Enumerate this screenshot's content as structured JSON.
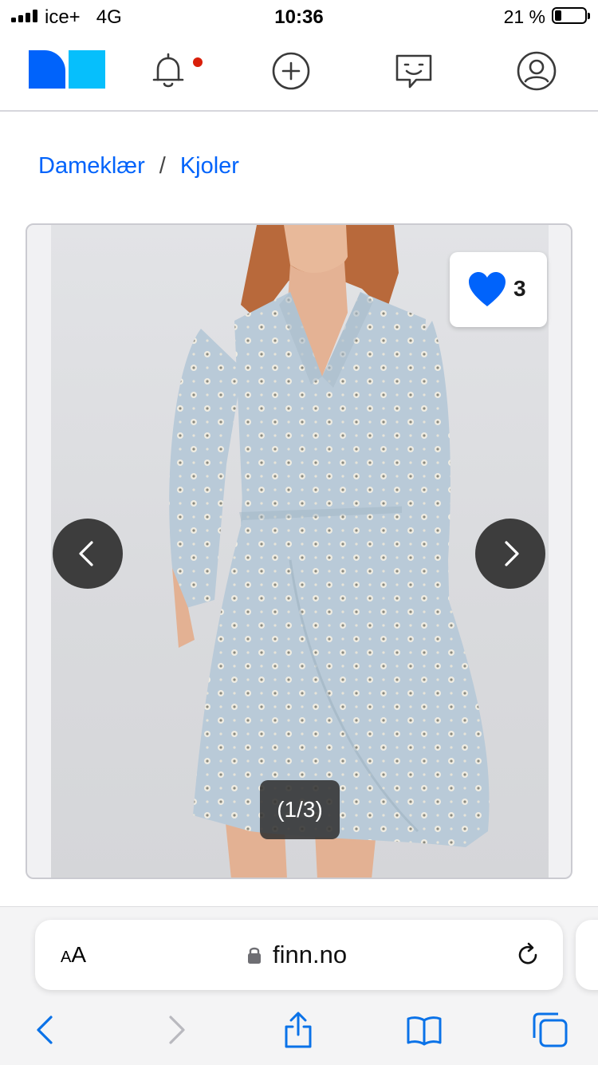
{
  "status": {
    "carrier": "ice+",
    "network": "4G",
    "time": "10:36",
    "battery_pct": "21 %",
    "battery_fraction": 0.21
  },
  "header": {
    "icons": [
      "finn-logo",
      "bell-icon",
      "plus-circle-icon",
      "chat-icon",
      "profile-icon"
    ],
    "has_notification": true
  },
  "breadcrumb": {
    "items": [
      "Dameklær",
      "Kjoler"
    ],
    "separator": "/"
  },
  "gallery": {
    "favorite_count": "3",
    "counter": "(1/3)",
    "image_desc": "photo-of-light-blue-wrap-dress"
  },
  "browser": {
    "text_size_big": "A",
    "text_size_small": "A",
    "url": "finn.no"
  },
  "colors": {
    "brand_blue": "#0063fb",
    "brand_cyan": "#06bffc",
    "link": "#0063fb",
    "dot": "#d91f0a"
  }
}
